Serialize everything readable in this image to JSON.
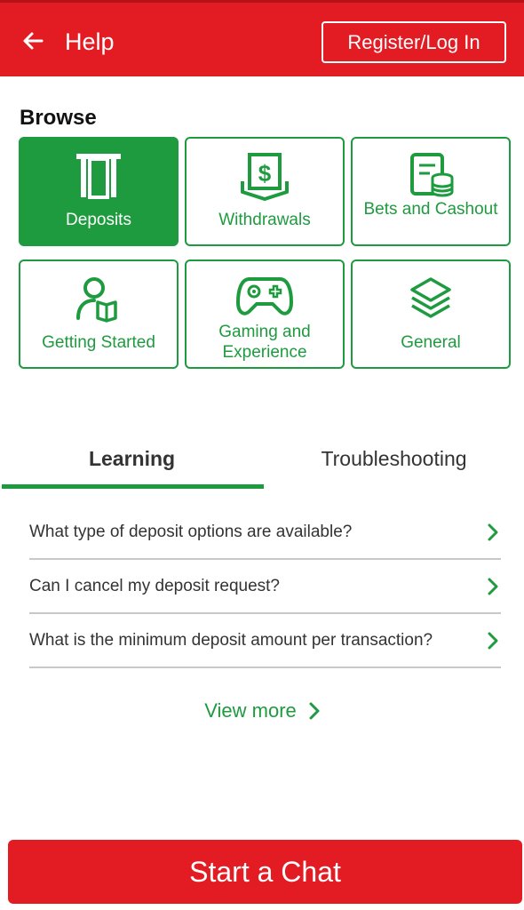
{
  "header": {
    "title": "Help",
    "login_label": "Register/Log In",
    "back_icon": "arrow-left-icon"
  },
  "browse": {
    "title": "Browse",
    "tiles": [
      {
        "label": "Deposits",
        "icon": "deposit-icon",
        "active": true
      },
      {
        "label": "Withdrawals",
        "icon": "withdrawal-icon",
        "active": false
      },
      {
        "label": "Bets and Cashout",
        "icon": "bets-cashout-icon",
        "active": false
      },
      {
        "label": "Getting Started",
        "icon": "getting-started-icon",
        "active": false
      },
      {
        "label": "Gaming and Experience",
        "icon": "gamepad-icon",
        "active": false
      },
      {
        "label": "General",
        "icon": "layers-icon",
        "active": false
      }
    ]
  },
  "tabs": [
    {
      "label": "Learning",
      "selected": true
    },
    {
      "label": "Troubleshooting",
      "selected": false
    }
  ],
  "faqs": [
    {
      "question": "What type of deposit options are available?"
    },
    {
      "question": "Can I cancel my deposit request?"
    },
    {
      "question": "What is the minimum deposit amount per transaction?"
    }
  ],
  "view_more_label": "View more",
  "chat_button_label": "Start a Chat",
  "colors": {
    "brand_red": "#e31b23",
    "brand_green": "#1e9b3f"
  }
}
